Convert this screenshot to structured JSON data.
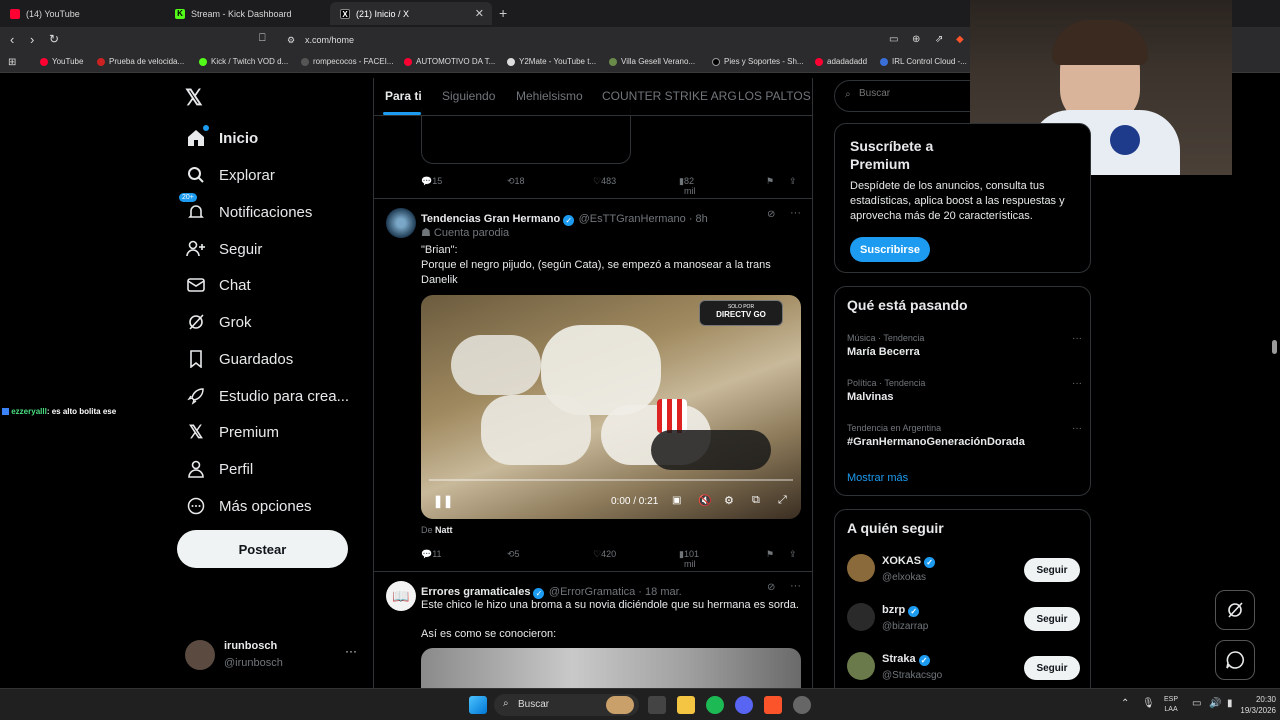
{
  "browser": {
    "tabs": [
      {
        "title": "(14) YouTube",
        "icon": "youtube-icon",
        "color": "#ff0033"
      },
      {
        "title": "Stream - Kick Dashboard",
        "icon": "kick-icon",
        "color": "#53fc18"
      },
      {
        "title": "(21) Inicio / X",
        "icon": "x-icon",
        "color": "#ffffff"
      }
    ],
    "url": "x.com/home",
    "bookmarks": [
      "YouTube",
      "Prueba de velocida...",
      "Kick / Twitch VOD d...",
      "rompecocos - FACEI...",
      "AUTOMOTIVO DA T...",
      "Y2Mate - YouTube t...",
      "Villa Gesell Verano...",
      "Pies y Soportes - Sh...",
      "adadadadd",
      "IRL Control Cloud -..."
    ]
  },
  "nav": {
    "items": [
      {
        "label": "Inicio",
        "icon": "home-icon",
        "bold": true
      },
      {
        "label": "Explorar",
        "icon": "search-icon"
      },
      {
        "label": "Notificaciones",
        "icon": "bell-icon",
        "badge": "20+"
      },
      {
        "label": "Seguir",
        "icon": "follow-icon"
      },
      {
        "label": "Chat",
        "icon": "mail-icon"
      },
      {
        "label": "Grok",
        "icon": "grok-icon"
      },
      {
        "label": "Guardados",
        "icon": "bookmark-icon"
      },
      {
        "label": "Estudio para crea...",
        "icon": "rocket-icon"
      },
      {
        "label": "Premium",
        "icon": "x-logo-icon"
      },
      {
        "label": "Perfil",
        "icon": "person-icon"
      },
      {
        "label": "Más opciones",
        "icon": "more-circle-icon"
      }
    ],
    "post_label": "Postear",
    "user": {
      "name": "irunbosch",
      "handle": "@irunbosch"
    }
  },
  "chat_overlay": {
    "user": "ezzeryalll",
    "message": ": es alto bolita ese"
  },
  "feed": {
    "tabs": [
      "Para ti",
      "Siguiendo",
      "Mehielsismo",
      "COUNTER STRIKE ARG",
      "LOS PALTOS"
    ],
    "prev_actions": {
      "replies": "15",
      "reposts": "18",
      "likes": "483",
      "views": "82 mil"
    },
    "tweet1": {
      "name": "Tendencias Gran Hermano",
      "handle": "@EsTTGranHermano · 8h",
      "parody": "Cuenta parodia",
      "text1": "\"Brian\":",
      "text2": "Porque el negro pijudo, (según Cata), se empezó a manosear a la trans Danelik",
      "video_badge_top": "SOLO POR",
      "video_badge": "DIRECTV GO",
      "video_time": "0:00 / 0:21",
      "from_label": "De",
      "from_user": "Natt",
      "replies": "11",
      "reposts": "5",
      "likes": "420",
      "views": "101 mil"
    },
    "tweet2": {
      "name": "Errores gramaticales",
      "handle": "@ErrorGramatica · 18 mar.",
      "text1": "Este chico le hizo una broma a su novia diciéndole que su hermana es sorda.",
      "text2": "Así es como se conocieron:"
    }
  },
  "sidebar": {
    "search_placeholder": "Buscar",
    "premium": {
      "title": "Suscríbete a Premium",
      "body": "Despídete de los anuncios, consulta tus estadísticas, aplica boost a las respuestas y aprovecha más de 20 características.",
      "button": "Suscribirse"
    },
    "trends": {
      "title": "Qué está pasando",
      "items": [
        {
          "context": "Música · Tendencia",
          "name": "María Becerra"
        },
        {
          "context": "Política · Tendencia",
          "name": "Malvinas"
        },
        {
          "context": "Tendencia en Argentina",
          "name": "#GranHermanoGeneraciónDorada"
        }
      ],
      "more": "Mostrar más"
    },
    "who_to_follow": {
      "title": "A quién seguir",
      "follow_label": "Seguir",
      "accounts": [
        {
          "name": "XOKAS",
          "handle": "@elxokas"
        },
        {
          "name": "bzrp",
          "handle": "@bizarrap"
        },
        {
          "name": "Straka",
          "handle": "@Strakacsgo"
        }
      ]
    }
  },
  "taskbar": {
    "search": "Buscar",
    "lang1": "ESP",
    "lang2": "LAA",
    "time": "20:30",
    "date": "19/3/2026"
  }
}
